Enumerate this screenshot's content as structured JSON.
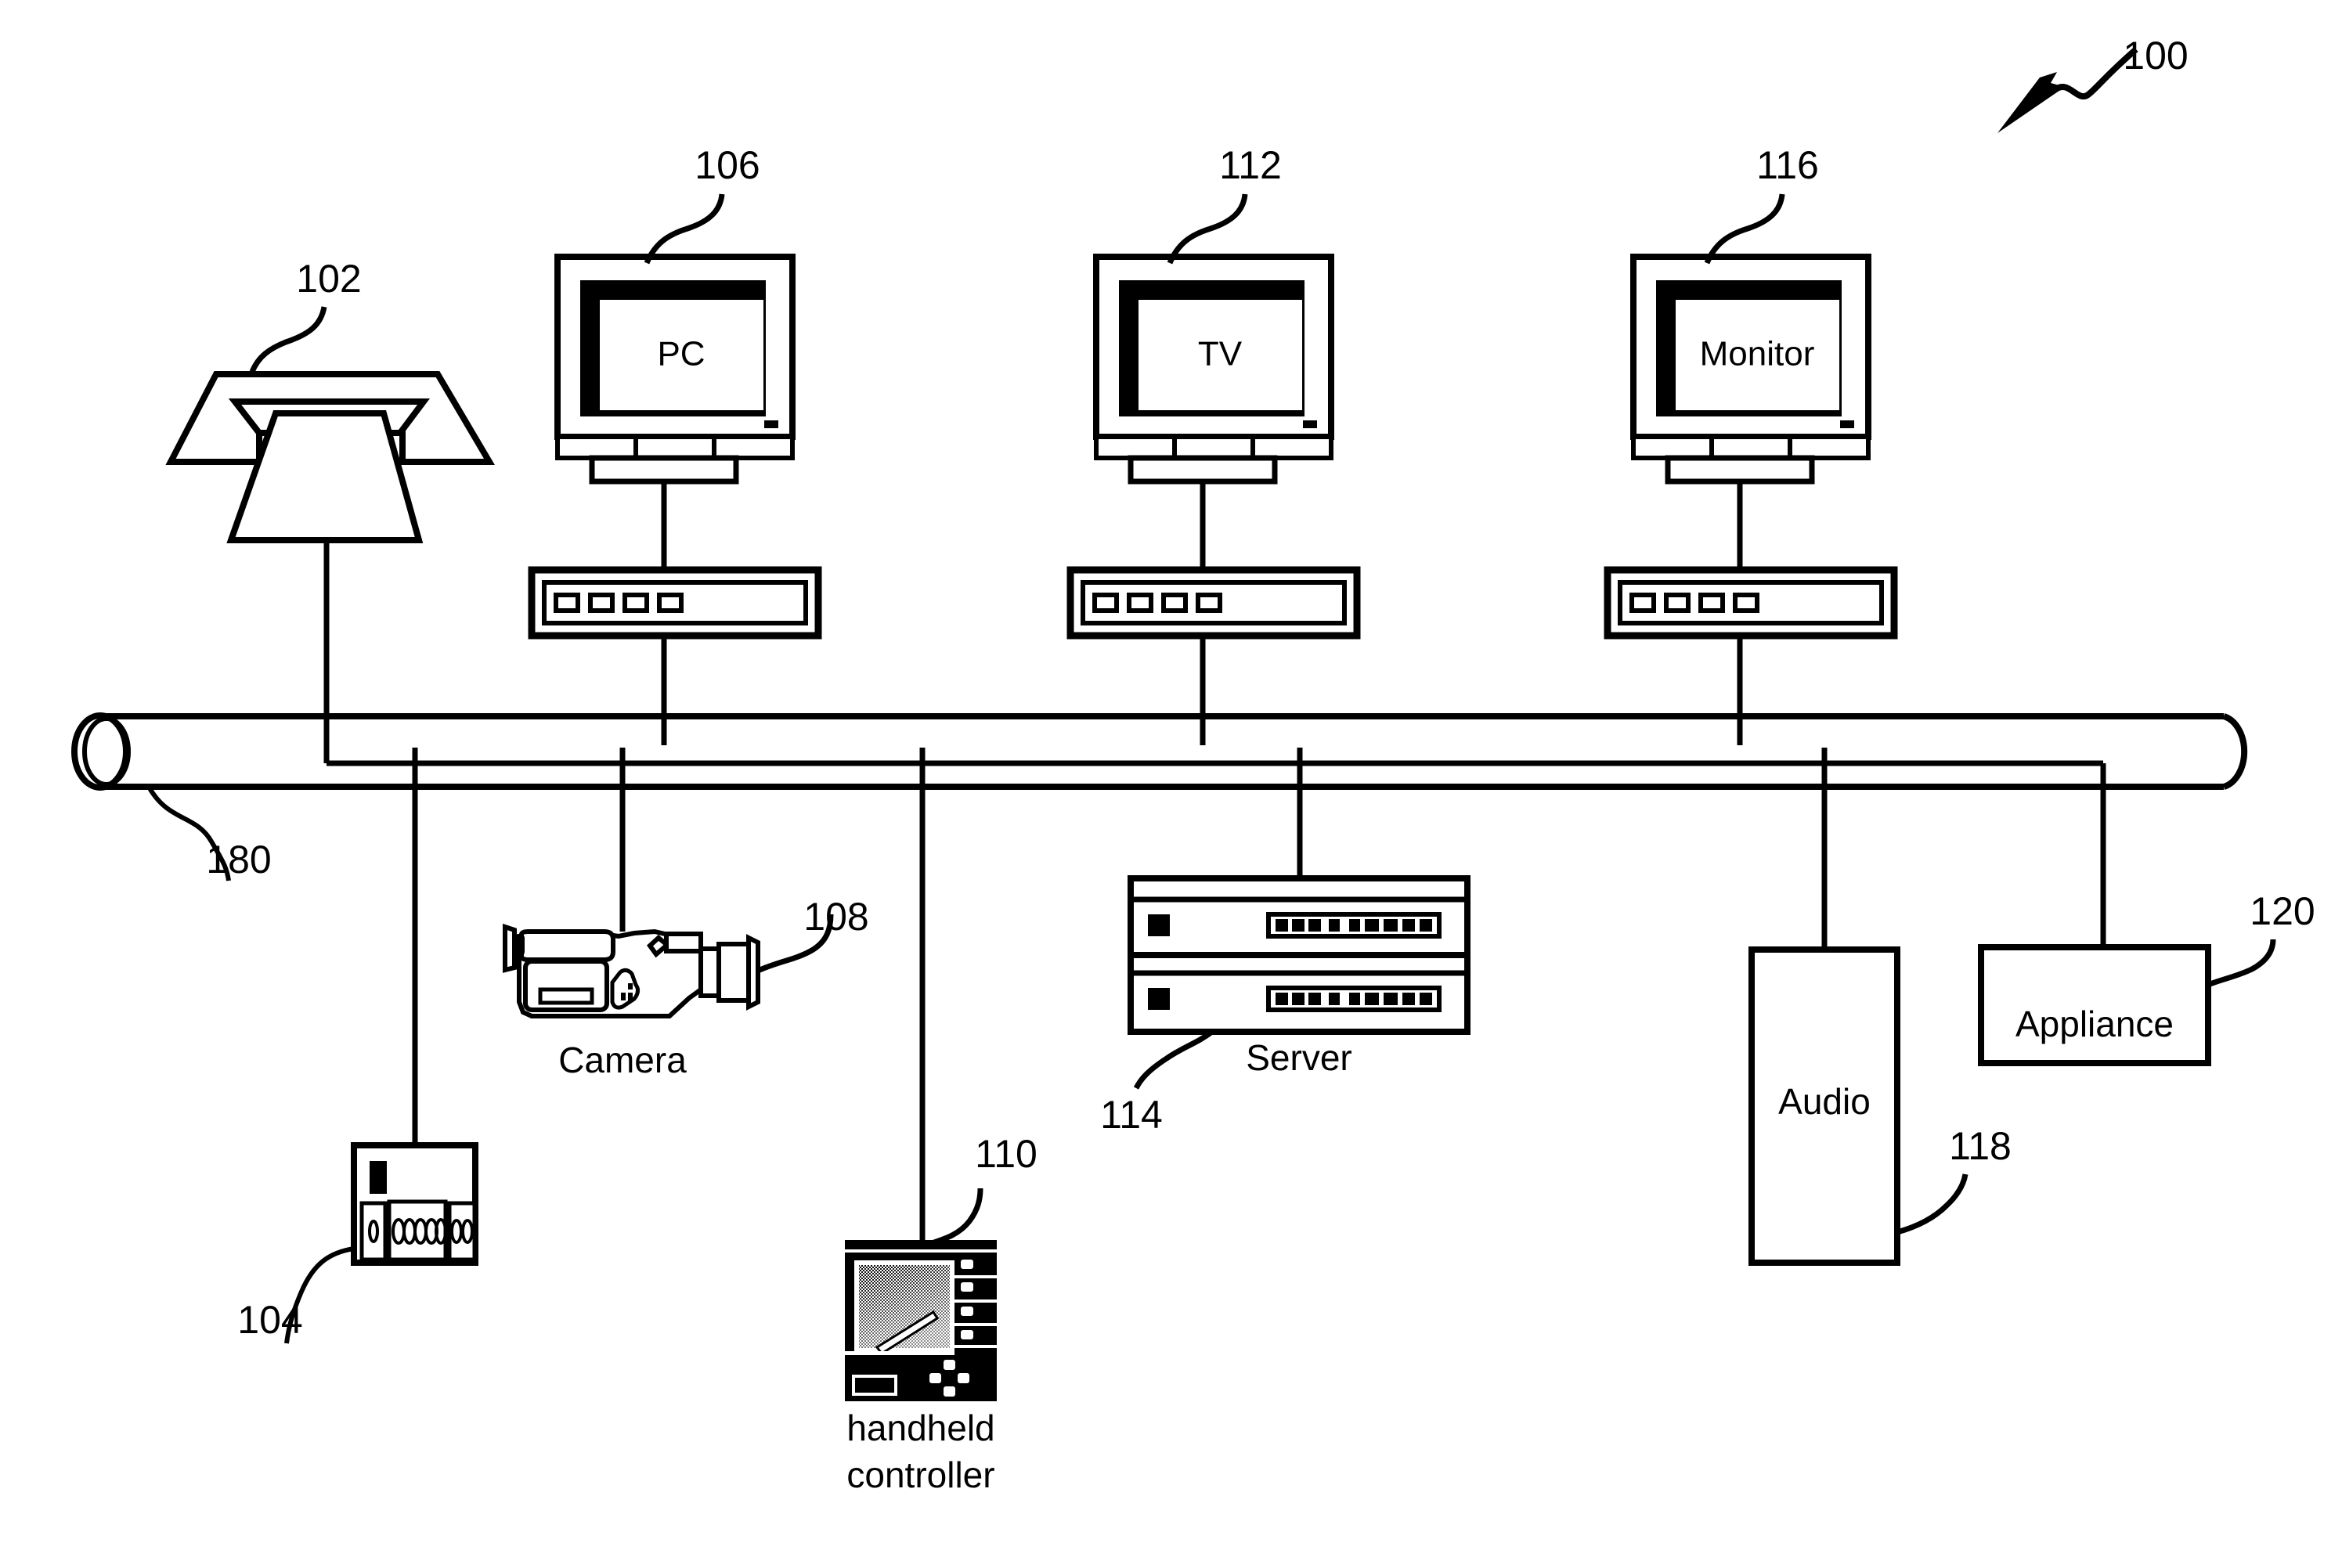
{
  "figure": {
    "title_ref": "100",
    "bus": {
      "ref": "180",
      "name": "network-bus"
    },
    "nodes": [
      {
        "id": "antenna",
        "ref": "102",
        "label": "",
        "kind": "antenna-dish"
      },
      {
        "id": "receiver",
        "ref": "104",
        "label": "",
        "kind": "receiver-box"
      },
      {
        "id": "pc",
        "ref": "106",
        "label": "PC",
        "kind": "monitor-with-settop"
      },
      {
        "id": "camera",
        "ref": "108",
        "label": "Camera",
        "kind": "camcorder"
      },
      {
        "id": "handheld",
        "ref": "110",
        "label": "handheld controller",
        "label_line1": "handheld",
        "label_line2": "controller",
        "kind": "handheld-controller"
      },
      {
        "id": "tv",
        "ref": "112",
        "label": "TV",
        "kind": "monitor-with-settop"
      },
      {
        "id": "server",
        "ref": "114",
        "label": "Server",
        "kind": "rack-server"
      },
      {
        "id": "monitor",
        "ref": "116",
        "label": "Monitor",
        "kind": "monitor-with-settop"
      },
      {
        "id": "audio",
        "ref": "118",
        "label": "Audio",
        "kind": "tall-box"
      },
      {
        "id": "appliance",
        "ref": "120",
        "label": "Appliance",
        "kind": "wide-box"
      }
    ],
    "colors": {
      "ink": "#000000",
      "paper": "#ffffff"
    },
    "settop_button_count": 4,
    "server_bay_count": 9
  }
}
